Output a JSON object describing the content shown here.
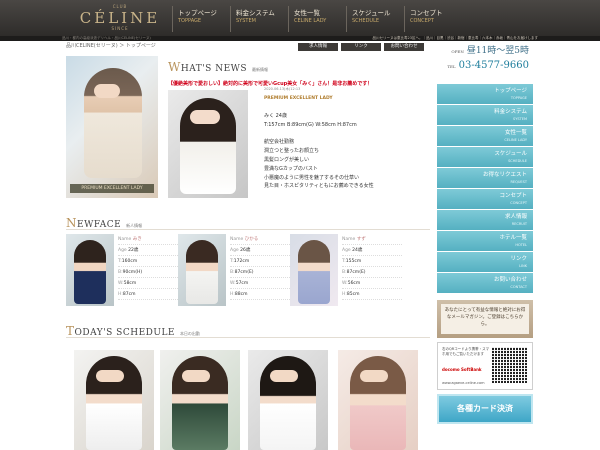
{
  "header": {
    "logo": {
      "small": "CLUB",
      "main": "CÉLINE",
      "sub": "SINCE"
    },
    "nav": [
      {
        "jp": "トップページ",
        "en": "TOPPAGE"
      },
      {
        "jp": "料金システム",
        "en": "SYSTEM"
      },
      {
        "jp": "女性一覧",
        "en": "CELINE LADY"
      },
      {
        "jp": "スケジュール",
        "en": "SCHEDULE"
      },
      {
        "jp": "コンセプト",
        "en": "CONCEPT"
      }
    ],
    "subheader_left": "品川・都内の高級派遣デリヘル・品川CELINE(セリーヌ)",
    "subheader_right": "品川セリーヌは恵比寿23区へ。｜品川｜目黒｜渋谷｜新宿｜恵比寿｜六本木｜赤坂｜青山をお届けします"
  },
  "breadcrumb": "品川CELINE(セリーヌ) ＞ トップページ",
  "mini_buttons": [
    "求人情報",
    "リンク",
    "お問い合わせ"
  ],
  "feature": {
    "tag": "PREMIUM EXCELLENT LADY"
  },
  "news": {
    "title_cap": "W",
    "title_rest": "HAT'S NEWS",
    "title_jp": "最新情報",
    "headline": "【優絶美形で愛おしい】絶対的に美形で可愛いGcup美女「みく」さん！是非お薦めです！",
    "date": "2020.06.13(木)12:13",
    "lady_label": "PREMIUM EXCELLENT LADY",
    "body": [
      "みく 24歳",
      "T:157cm B:89cm(G) W:58cm H:87cm",
      "",
      "航空会社勤務",
      "潤立つと整ったお顔立ち",
      "黒髪ロングが美しい",
      "豊満なGカップのバスト",
      "小悪魔のように男性を魅了するその仕草い",
      "見た目・ホスピタリティともにお薦めできる女性"
    ]
  },
  "newface": {
    "title_cap": "N",
    "title_rest": "EWFACE",
    "title_jp": "新人情報",
    "labels": {
      "name": "Name",
      "age": "Age",
      "t": "T:",
      "b": "B:",
      "w": "W:",
      "h": "H:"
    },
    "items": [
      {
        "name": "みき",
        "age": "22歳",
        "t": "160cm",
        "b": "90cm(H)",
        "w": "58cm",
        "h": "87cm"
      },
      {
        "name": "ひかる",
        "age": "26歳",
        "t": "172cm",
        "b": "87cm(E)",
        "w": "57cm",
        "h": "88cm"
      },
      {
        "name": "すず",
        "age": "24歳",
        "t": "155cm",
        "b": "87cm(E)",
        "w": "56cm",
        "h": "85cm"
      }
    ]
  },
  "schedule": {
    "title_cap": "T",
    "title_rest": "ODAY'S SCHEDULE",
    "title_jp": "本日の出勤"
  },
  "sidebar": {
    "open_label": "OPEN",
    "open_hours": "昼11時〜翌5時",
    "tel_label": "TEL",
    "tel": "03-4577-9660",
    "menu": [
      {
        "jp": "トップページ",
        "en": "TOPPAGE"
      },
      {
        "jp": "料金システム",
        "en": "SYSTEM"
      },
      {
        "jp": "女性一覧",
        "en": "CELINE LADY"
      },
      {
        "jp": "スケジュール",
        "en": "SCHEDULE"
      },
      {
        "jp": "お得なリクエスト",
        "en": "REQUEST"
      },
      {
        "jp": "コンセプト",
        "en": "CONCEPT"
      },
      {
        "jp": "求人情報",
        "en": "RECRUIT"
      },
      {
        "jp": "ホテル一覧",
        "en": "HOTEL"
      },
      {
        "jp": "リンク",
        "en": "LINK"
      },
      {
        "jp": "お問い合わせ",
        "en": "CONTACT"
      }
    ],
    "magazine": "あなたにとって有益な情報と絶対にお得なメールマガジン。ご登録はこちらから。",
    "qr_text": "右のQRコードより携帯・スマホ用でもご覧いただけます",
    "carriers": "docomo SoftBank",
    "qr_url": "www.agaeve-celine.com",
    "card_banner": "各種カード決済"
  },
  "colors": {
    "header_bg": "#3a3835",
    "nav_gold": "#c7a96a",
    "sidebar_teal": "#55b0c1",
    "headline_red": "#d0021b"
  }
}
